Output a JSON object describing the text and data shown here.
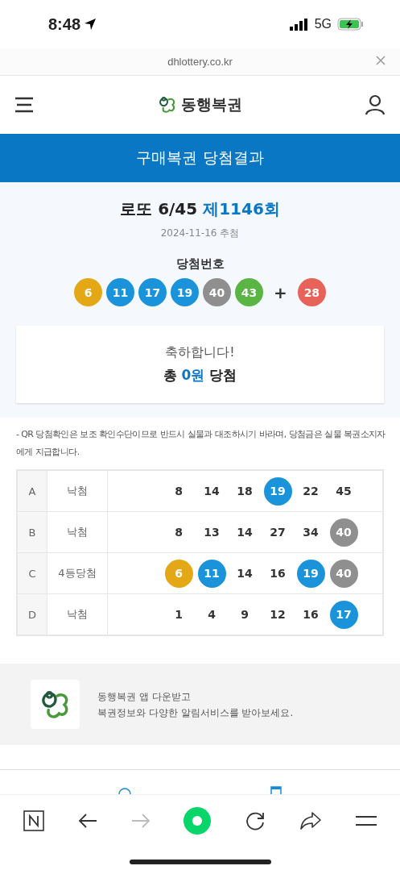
{
  "status_bar": {
    "time": "8:48",
    "network": "5G"
  },
  "browser": {
    "url": "dhlottery.co.kr"
  },
  "header": {
    "logo_text": "동행복권"
  },
  "banner": {
    "title": "구매복권 당첨결과"
  },
  "draw": {
    "game": "로또 6/45",
    "round": "제1146회",
    "date": "2024-11-16 추첨",
    "label": "당첨번호",
    "numbers": [
      {
        "n": "6",
        "color": "#e4a716"
      },
      {
        "n": "11",
        "color": "#1a93da"
      },
      {
        "n": "17",
        "color": "#1a93da"
      },
      {
        "n": "19",
        "color": "#1a93da"
      },
      {
        "n": "40",
        "color": "#8f8f8f"
      },
      {
        "n": "43",
        "color": "#5ab545"
      }
    ],
    "plus": "+",
    "bonus": {
      "n": "28",
      "color": "#e7635a"
    }
  },
  "result": {
    "message": "축하합니다!",
    "prefix": "총",
    "amount": "0원",
    "suffix": "당첨"
  },
  "notice": "- QR 당첨확인은 보조 확인수단이므로 반드시 실물과 대조하시기 바라며, 당첨금은 실물 복권소지자에게 지급합니다.",
  "table": {
    "rows": [
      {
        "game": "A",
        "result": "낙첨",
        "numbers": [
          {
            "n": "8"
          },
          {
            "n": "14"
          },
          {
            "n": "18"
          },
          {
            "n": "19",
            "color": "#1a93da"
          },
          {
            "n": "22"
          },
          {
            "n": "45"
          }
        ]
      },
      {
        "game": "B",
        "result": "낙첨",
        "numbers": [
          {
            "n": "8"
          },
          {
            "n": "13"
          },
          {
            "n": "14"
          },
          {
            "n": "27"
          },
          {
            "n": "34"
          },
          {
            "n": "40",
            "color": "#8f8f8f"
          }
        ]
      },
      {
        "game": "C",
        "result": "4등당첨",
        "numbers": [
          {
            "n": "6",
            "color": "#e4a716"
          },
          {
            "n": "11",
            "color": "#1a93da"
          },
          {
            "n": "14"
          },
          {
            "n": "16"
          },
          {
            "n": "19",
            "color": "#1a93da"
          },
          {
            "n": "40",
            "color": "#8f8f8f"
          }
        ]
      },
      {
        "game": "D",
        "result": "낙첨",
        "numbers": [
          {
            "n": "1"
          },
          {
            "n": "4"
          },
          {
            "n": "9"
          },
          {
            "n": "12"
          },
          {
            "n": "16"
          },
          {
            "n": "17",
            "color": "#1a93da"
          }
        ]
      }
    ]
  },
  "app_promo": {
    "line1": "동행복권 앱 다운받고",
    "line2": "복권정보와 다양한 알림서비스를 받아보세요."
  }
}
